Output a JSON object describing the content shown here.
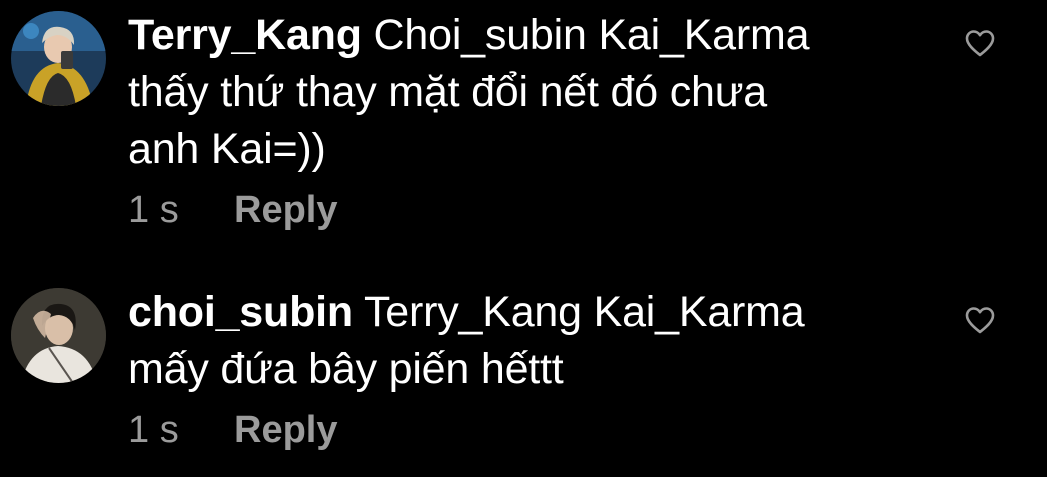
{
  "comments": [
    {
      "username": "Terry_Kang",
      "text": "Choi_subin Kai_Karma",
      "text_line2": "thấy thứ thay mặt đổi nết đó chưa",
      "text_line3": "anh Kai=))",
      "time": "1 s",
      "reply_label": "Reply",
      "like_icon": "heart-outline-icon"
    },
    {
      "username": "choi_subin",
      "text": "Terry_Kang Kai_Karma",
      "text_line2": "mấy đứa bây piến hếttt",
      "time": "1 s",
      "reply_label": "Reply",
      "like_icon": "heart-outline-icon"
    }
  ],
  "colors": {
    "background": "#000000",
    "text": "#ffffff",
    "meta": "#9b9b9b",
    "icon": "#9b9b9b"
  }
}
